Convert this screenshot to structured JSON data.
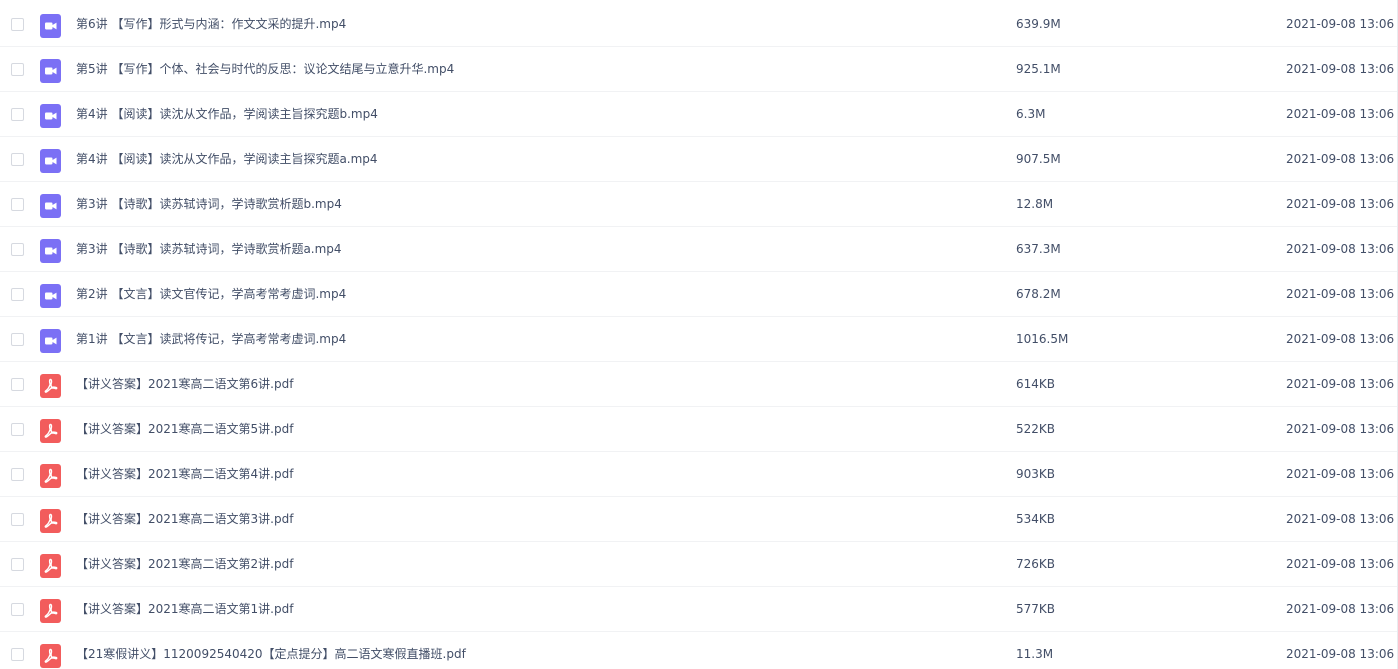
{
  "colors": {
    "video_icon": "#7b70f5",
    "pdf_icon": "#f25c5c",
    "text": "#424e67",
    "row_border": "#f1f2f4"
  },
  "files": [
    {
      "name": "第6讲 【写作】形式与内涵：作文文采的提升.mp4",
      "size": "639.9M",
      "date": "2021-09-08 13:06",
      "icon": "video-icon"
    },
    {
      "name": "第5讲 【写作】个体、社会与时代的反思：议论文结尾与立意升华.mp4",
      "size": "925.1M",
      "date": "2021-09-08 13:06",
      "icon": "video-icon"
    },
    {
      "name": "第4讲 【阅读】读沈从文作品，学阅读主旨探究题b.mp4",
      "size": "6.3M",
      "date": "2021-09-08 13:06",
      "icon": "video-icon"
    },
    {
      "name": "第4讲 【阅读】读沈从文作品，学阅读主旨探究题a.mp4",
      "size": "907.5M",
      "date": "2021-09-08 13:06",
      "icon": "video-icon"
    },
    {
      "name": "第3讲 【诗歌】读苏轼诗词，学诗歌赏析题b.mp4",
      "size": "12.8M",
      "date": "2021-09-08 13:06",
      "icon": "video-icon"
    },
    {
      "name": "第3讲 【诗歌】读苏轼诗词，学诗歌赏析题a.mp4",
      "size": "637.3M",
      "date": "2021-09-08 13:06",
      "icon": "video-icon"
    },
    {
      "name": "第2讲 【文言】读文官传记，学高考常考虚词.mp4",
      "size": "678.2M",
      "date": "2021-09-08 13:06",
      "icon": "video-icon"
    },
    {
      "name": "第1讲 【文言】读武将传记，学高考常考虚词.mp4",
      "size": "1016.5M",
      "date": "2021-09-08 13:06",
      "icon": "video-icon"
    },
    {
      "name": "【讲义答案】2021寒高二语文第6讲.pdf",
      "size": "614KB",
      "date": "2021-09-08 13:06",
      "icon": "pdf-icon"
    },
    {
      "name": "【讲义答案】2021寒高二语文第5讲.pdf",
      "size": "522KB",
      "date": "2021-09-08 13:06",
      "icon": "pdf-icon"
    },
    {
      "name": "【讲义答案】2021寒高二语文第4讲.pdf",
      "size": "903KB",
      "date": "2021-09-08 13:06",
      "icon": "pdf-icon"
    },
    {
      "name": "【讲义答案】2021寒高二语文第3讲.pdf",
      "size": "534KB",
      "date": "2021-09-08 13:06",
      "icon": "pdf-icon"
    },
    {
      "name": "【讲义答案】2021寒高二语文第2讲.pdf",
      "size": "726KB",
      "date": "2021-09-08 13:06",
      "icon": "pdf-icon"
    },
    {
      "name": "【讲义答案】2021寒高二语文第1讲.pdf",
      "size": "577KB",
      "date": "2021-09-08 13:06",
      "icon": "pdf-icon"
    },
    {
      "name": "【21寒假讲义】1120092540420【定点提分】高二语文寒假直播班.pdf",
      "size": "11.3M",
      "date": "2021-09-08 13:06",
      "icon": "pdf-icon"
    }
  ]
}
